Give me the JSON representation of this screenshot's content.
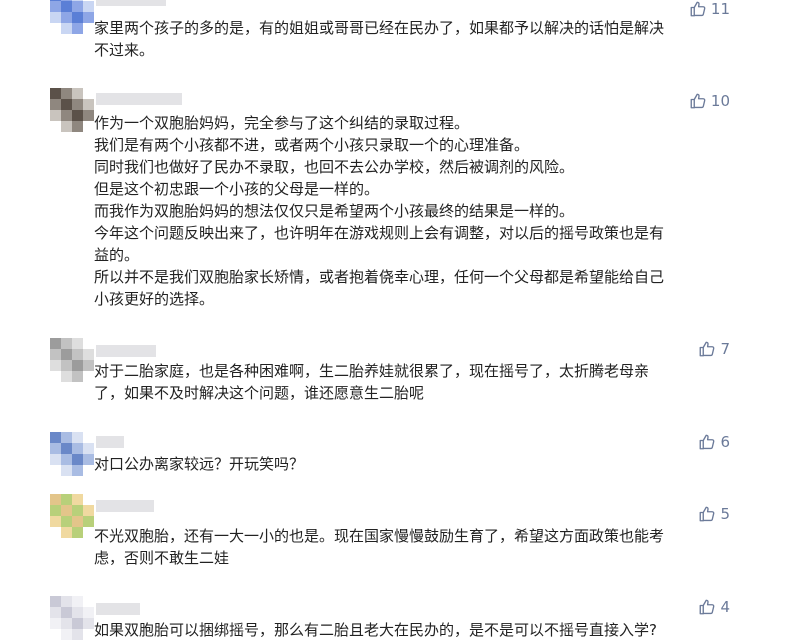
{
  "comments": [
    {
      "likes": "11",
      "lines": [
        "家里两个孩子的多的是，有的姐姐或哥哥已经在民办了，如果都予以解决的话怕是解决",
        "不过来。"
      ]
    },
    {
      "likes": "10",
      "lines": [
        "作为一个双胞胎妈妈，完全参与了这个纠结的录取过程。",
        "我们是有两个小孩都不进，或者两个小孩只录取一个的心理准备。",
        "同时我们也做好了民办不录取，也回不去公办学校，然后被调剂的风险。",
        "但是这个初忠跟一个小孩的父母是一样的。",
        "而我作为双胞胎妈妈的想法仅仅只是希望两个小孩最终的结果是一样的。",
        "今年这个问题反映出来了，也许明年在游戏规则上会有调整，对以后的摇号政策也是有",
        "益的。",
        "所以并不是我们双胞胎家长矫情，或者抱着侥幸心理，任何一个父母都是希望能给自己",
        "小孩更好的选择。"
      ]
    },
    {
      "likes": "7",
      "lines": [
        "对于二胎家庭，也是各种困难啊，生二胎养娃就很累了，现在摇号了，太折腾老母亲",
        "了，如果不及时解决这个问题，谁还愿意生二胎呢"
      ]
    },
    {
      "likes": "6",
      "lines": [
        "对口公办离家较远？开玩笑吗？"
      ]
    },
    {
      "likes": "5",
      "lines": [
        "不光双胞胎，还有一大一小的也是。现在国家慢慢鼓励生育了，希望这方面政策也能考",
        "虑，否则不敢生二娃"
      ]
    },
    {
      "likes": "4",
      "lines": [
        "如果双胞胎可以捆绑摇号，那么有二胎且老大在民办的，是不是可以不摇号直接入学?"
      ]
    }
  ],
  "colors": {
    "like_icon": "#6b7a99",
    "text": "#222222",
    "avatar_palettes": [
      [
        "#5b7fd6",
        "#8ea6e6",
        "#c9d6f3",
        "#ffffff"
      ],
      [
        "#5b5149",
        "#8f877f",
        "#c9c4be",
        "#ffffff"
      ],
      [
        "#9c9c9c",
        "#c2c2c2",
        "#dedede",
        "#ffffff"
      ],
      [
        "#6a88c8",
        "#a9bce3",
        "#d9e1f2",
        "#ffffff"
      ],
      [
        "#e3c58a",
        "#b8d07a",
        "#f0d9a0",
        "#ffffff"
      ],
      [
        "#c9c9d6",
        "#e3e3ea",
        "#f1f1f5",
        "#ffffff"
      ]
    ]
  }
}
